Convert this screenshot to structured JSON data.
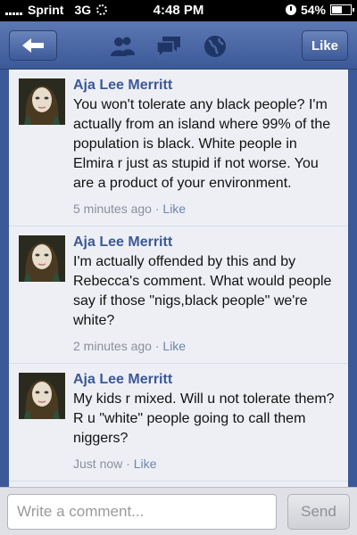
{
  "statusbar": {
    "carrier": "Sprint",
    "network": "3G",
    "time": "4:48 PM",
    "battery": "54%",
    "battery_level": 0.54
  },
  "navbar": {
    "like_label": "Like",
    "icons": [
      "back-arrow-icon",
      "friends-icon",
      "messages-icon",
      "globe-icon"
    ]
  },
  "comments": [
    {
      "name": "Aja Lee Merritt",
      "text": "You won't tolerate any black people? I'm actually from an island where 99% of the population is black. White people in Elmira r just as stupid if not worse. You are a product of your environment.",
      "time": "5 minutes ago",
      "like": "Like"
    },
    {
      "name": "Aja Lee Merritt",
      "text": "I'm actually offended by this and by Rebecca's comment. What would people say if those \"nigs,black people\" we're white?",
      "time": "2 minutes ago",
      "like": "Like"
    },
    {
      "name": "Aja Lee Merritt",
      "text": "My kids r mixed. Will u not tolerate them? R u \"white\" people going to call them niggers?",
      "time": "Just now",
      "like": "Like"
    }
  ],
  "composer": {
    "placeholder": "Write a comment...",
    "send_label": "Send"
  },
  "colors": {
    "brand": "#3b5998",
    "name": "#3b5998",
    "background": "#edeff4"
  }
}
